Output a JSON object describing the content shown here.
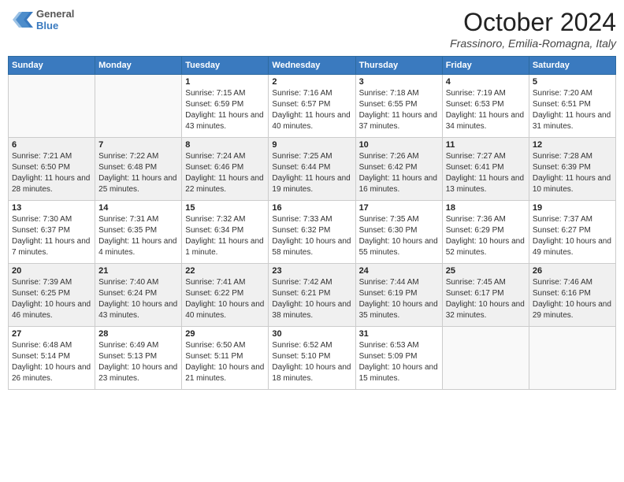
{
  "header": {
    "logo": {
      "general": "General",
      "blue": "Blue"
    },
    "title": "October 2024",
    "location": "Frassinoro, Emilia-Romagna, Italy"
  },
  "weekdays": [
    "Sunday",
    "Monday",
    "Tuesday",
    "Wednesday",
    "Thursday",
    "Friday",
    "Saturday"
  ],
  "weeks": [
    [
      {
        "day": "",
        "sunrise": "",
        "sunset": "",
        "daylight": ""
      },
      {
        "day": "",
        "sunrise": "",
        "sunset": "",
        "daylight": ""
      },
      {
        "day": "1",
        "sunrise": "Sunrise: 7:15 AM",
        "sunset": "Sunset: 6:59 PM",
        "daylight": "Daylight: 11 hours and 43 minutes."
      },
      {
        "day": "2",
        "sunrise": "Sunrise: 7:16 AM",
        "sunset": "Sunset: 6:57 PM",
        "daylight": "Daylight: 11 hours and 40 minutes."
      },
      {
        "day": "3",
        "sunrise": "Sunrise: 7:18 AM",
        "sunset": "Sunset: 6:55 PM",
        "daylight": "Daylight: 11 hours and 37 minutes."
      },
      {
        "day": "4",
        "sunrise": "Sunrise: 7:19 AM",
        "sunset": "Sunset: 6:53 PM",
        "daylight": "Daylight: 11 hours and 34 minutes."
      },
      {
        "day": "5",
        "sunrise": "Sunrise: 7:20 AM",
        "sunset": "Sunset: 6:51 PM",
        "daylight": "Daylight: 11 hours and 31 minutes."
      }
    ],
    [
      {
        "day": "6",
        "sunrise": "Sunrise: 7:21 AM",
        "sunset": "Sunset: 6:50 PM",
        "daylight": "Daylight: 11 hours and 28 minutes."
      },
      {
        "day": "7",
        "sunrise": "Sunrise: 7:22 AM",
        "sunset": "Sunset: 6:48 PM",
        "daylight": "Daylight: 11 hours and 25 minutes."
      },
      {
        "day": "8",
        "sunrise": "Sunrise: 7:24 AM",
        "sunset": "Sunset: 6:46 PM",
        "daylight": "Daylight: 11 hours and 22 minutes."
      },
      {
        "day": "9",
        "sunrise": "Sunrise: 7:25 AM",
        "sunset": "Sunset: 6:44 PM",
        "daylight": "Daylight: 11 hours and 19 minutes."
      },
      {
        "day": "10",
        "sunrise": "Sunrise: 7:26 AM",
        "sunset": "Sunset: 6:42 PM",
        "daylight": "Daylight: 11 hours and 16 minutes."
      },
      {
        "day": "11",
        "sunrise": "Sunrise: 7:27 AM",
        "sunset": "Sunset: 6:41 PM",
        "daylight": "Daylight: 11 hours and 13 minutes."
      },
      {
        "day": "12",
        "sunrise": "Sunrise: 7:28 AM",
        "sunset": "Sunset: 6:39 PM",
        "daylight": "Daylight: 11 hours and 10 minutes."
      }
    ],
    [
      {
        "day": "13",
        "sunrise": "Sunrise: 7:30 AM",
        "sunset": "Sunset: 6:37 PM",
        "daylight": "Daylight: 11 hours and 7 minutes."
      },
      {
        "day": "14",
        "sunrise": "Sunrise: 7:31 AM",
        "sunset": "Sunset: 6:35 PM",
        "daylight": "Daylight: 11 hours and 4 minutes."
      },
      {
        "day": "15",
        "sunrise": "Sunrise: 7:32 AM",
        "sunset": "Sunset: 6:34 PM",
        "daylight": "Daylight: 11 hours and 1 minute."
      },
      {
        "day": "16",
        "sunrise": "Sunrise: 7:33 AM",
        "sunset": "Sunset: 6:32 PM",
        "daylight": "Daylight: 10 hours and 58 minutes."
      },
      {
        "day": "17",
        "sunrise": "Sunrise: 7:35 AM",
        "sunset": "Sunset: 6:30 PM",
        "daylight": "Daylight: 10 hours and 55 minutes."
      },
      {
        "day": "18",
        "sunrise": "Sunrise: 7:36 AM",
        "sunset": "Sunset: 6:29 PM",
        "daylight": "Daylight: 10 hours and 52 minutes."
      },
      {
        "day": "19",
        "sunrise": "Sunrise: 7:37 AM",
        "sunset": "Sunset: 6:27 PM",
        "daylight": "Daylight: 10 hours and 49 minutes."
      }
    ],
    [
      {
        "day": "20",
        "sunrise": "Sunrise: 7:39 AM",
        "sunset": "Sunset: 6:25 PM",
        "daylight": "Daylight: 10 hours and 46 minutes."
      },
      {
        "day": "21",
        "sunrise": "Sunrise: 7:40 AM",
        "sunset": "Sunset: 6:24 PM",
        "daylight": "Daylight: 10 hours and 43 minutes."
      },
      {
        "day": "22",
        "sunrise": "Sunrise: 7:41 AM",
        "sunset": "Sunset: 6:22 PM",
        "daylight": "Daylight: 10 hours and 40 minutes."
      },
      {
        "day": "23",
        "sunrise": "Sunrise: 7:42 AM",
        "sunset": "Sunset: 6:21 PM",
        "daylight": "Daylight: 10 hours and 38 minutes."
      },
      {
        "day": "24",
        "sunrise": "Sunrise: 7:44 AM",
        "sunset": "Sunset: 6:19 PM",
        "daylight": "Daylight: 10 hours and 35 minutes."
      },
      {
        "day": "25",
        "sunrise": "Sunrise: 7:45 AM",
        "sunset": "Sunset: 6:17 PM",
        "daylight": "Daylight: 10 hours and 32 minutes."
      },
      {
        "day": "26",
        "sunrise": "Sunrise: 7:46 AM",
        "sunset": "Sunset: 6:16 PM",
        "daylight": "Daylight: 10 hours and 29 minutes."
      }
    ],
    [
      {
        "day": "27",
        "sunrise": "Sunrise: 6:48 AM",
        "sunset": "Sunset: 5:14 PM",
        "daylight": "Daylight: 10 hours and 26 minutes."
      },
      {
        "day": "28",
        "sunrise": "Sunrise: 6:49 AM",
        "sunset": "Sunset: 5:13 PM",
        "daylight": "Daylight: 10 hours and 23 minutes."
      },
      {
        "day": "29",
        "sunrise": "Sunrise: 6:50 AM",
        "sunset": "Sunset: 5:11 PM",
        "daylight": "Daylight: 10 hours and 21 minutes."
      },
      {
        "day": "30",
        "sunrise": "Sunrise: 6:52 AM",
        "sunset": "Sunset: 5:10 PM",
        "daylight": "Daylight: 10 hours and 18 minutes."
      },
      {
        "day": "31",
        "sunrise": "Sunrise: 6:53 AM",
        "sunset": "Sunset: 5:09 PM",
        "daylight": "Daylight: 10 hours and 15 minutes."
      },
      {
        "day": "",
        "sunrise": "",
        "sunset": "",
        "daylight": ""
      },
      {
        "day": "",
        "sunrise": "",
        "sunset": "",
        "daylight": ""
      }
    ]
  ]
}
